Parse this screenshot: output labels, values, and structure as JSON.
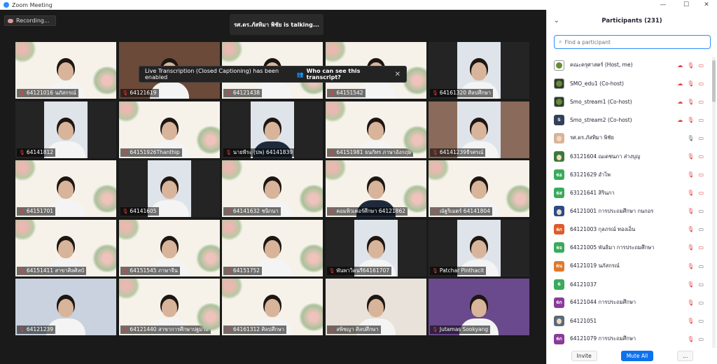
{
  "window": {
    "title": "Zoom Meeting",
    "minimize_icon": "—",
    "maximize_icon": "☐",
    "close_icon": "✕"
  },
  "recording": {
    "label": "Recording..."
  },
  "talking": {
    "text": "รศ.ดร.ภัสทิมา พิชัย is  talking..."
  },
  "banner": {
    "text": "Live Transcription (Closed Captioning) has been enabled",
    "link": "Who can see this transcript?",
    "close": "✕"
  },
  "tiles": [
    {
      "label": "64121016 นภัสกรณ์",
      "bg": "floral",
      "muted": true
    },
    {
      "label": "64121619",
      "bg": "wall",
      "muted": true
    },
    {
      "label": "64121438",
      "bg": "floral",
      "muted": true
    },
    {
      "label": "64151542",
      "bg": "floral",
      "muted": true
    },
    {
      "label": "64161320 ศิลปศึกษา",
      "bg": "dark",
      "muted": true
    },
    {
      "label": "64141812",
      "bg": "dark",
      "muted": true
    },
    {
      "label": "64151926Thanthip",
      "bg": "floral",
      "muted": true
    },
    {
      "label": "นายพีระ (ปพ) 64141839",
      "bg": "dark",
      "muted": true
    },
    {
      "label": "64151981 ธนกัทร ภาษาอังกฤษ",
      "bg": "floral",
      "muted": true
    },
    {
      "label": "64141239ธีรศรณ์",
      "bg": "warm",
      "muted": true
    },
    {
      "label": "64151701",
      "bg": "floral",
      "muted": true
    },
    {
      "label": "64141605",
      "bg": "dark",
      "muted": true
    },
    {
      "label": "64141632 ชนิกนา",
      "bg": "floral",
      "muted": true
    },
    {
      "label": "คอมพิวเตอร์ศึกษา 64121862",
      "bg": "floral",
      "muted": true
    },
    {
      "label": "ณัฐริเมตร์ 64141804",
      "bg": "floral",
      "muted": true
    },
    {
      "label": "64151411 สาขาศิลศิลป์",
      "bg": "floral",
      "muted": true
    },
    {
      "label": "64151545 ภาษาจีน",
      "bg": "floral",
      "muted": true
    },
    {
      "label": "64151752",
      "bg": "floral",
      "muted": true
    },
    {
      "label": "พันพาวิดนรี64161707",
      "bg": "dark",
      "muted": true
    },
    {
      "label": "Patchar Pinthacit",
      "bg": "dark",
      "muted": true
    },
    {
      "label": "64121239",
      "bg": "blue",
      "muted": true
    },
    {
      "label": "64121440 สาขาการศึกษาปฐมวัย",
      "bg": "floral",
      "muted": true
    },
    {
      "label": "64161312 ศิลปศึกษา",
      "bg": "floral",
      "muted": true
    },
    {
      "label": "สพิชญา ศิลปศึกษา",
      "bg": "light",
      "muted": true
    },
    {
      "label": "Jutamas Sookyang",
      "bg": "purple",
      "muted": true
    }
  ],
  "panel": {
    "title": "Participants (231)",
    "collapse_icon": "⌄",
    "search_placeholder": "Find a participant",
    "participants": [
      {
        "name": "คณะครุศาสตร์ (Host, me)",
        "avatar_text": "",
        "avatar_color": "#ffffff",
        "avatar_img": "logo",
        "mic": "off",
        "video": "off",
        "cloud": true
      },
      {
        "name": "SMO_edu1 (Co-host)",
        "avatar_text": "",
        "avatar_color": "#2b3b2b",
        "avatar_img": "logo",
        "mic": "off",
        "video": "off",
        "cloud": true
      },
      {
        "name": "Smo_stream1 (Co-host)",
        "avatar_text": "",
        "avatar_color": "#2b3b2b",
        "avatar_img": "logo",
        "mic": "off",
        "video": "off",
        "cloud": true
      },
      {
        "name": "Smo_stream2 (Co-host)",
        "avatar_text": "S",
        "avatar_color": "#32405a",
        "avatar_img": "",
        "mic": "off",
        "video": "off",
        "cloud": true
      },
      {
        "name": "รศ.ดร.ภัสทิมา พิชัย",
        "avatar_text": "",
        "avatar_color": "#d8b49a",
        "avatar_img": "photo",
        "mic": "on",
        "video": "off",
        "cloud": false
      },
      {
        "name": "63121604 ณเดชนภา ส่างบุญ",
        "avatar_text": "",
        "avatar_color": "#3a7a3a",
        "avatar_img": "photo",
        "mic": "off",
        "video": "off",
        "cloud": false
      },
      {
        "name": "63121629 อำไพ",
        "avatar_text": "6อ",
        "avatar_color": "#3aaa5c",
        "avatar_img": "",
        "mic": "off",
        "video": "off",
        "cloud": false
      },
      {
        "name": "63121641 สิรินภา",
        "avatar_text": "6ส",
        "avatar_color": "#3aaa5c",
        "avatar_img": "",
        "mic": "off",
        "video": "off",
        "cloud": false
      },
      {
        "name": "64121001 การประถมศึกษา กนกอร",
        "avatar_text": "",
        "avatar_color": "#2b4b8a",
        "avatar_img": "photo",
        "mic": "off",
        "video": "on",
        "cloud": false
      },
      {
        "name": "64121003 กุลภรณ์ ทองเอ็น",
        "avatar_text": "6ก",
        "avatar_color": "#e05a2a",
        "avatar_img": "",
        "mic": "off",
        "video": "on",
        "cloud": false
      },
      {
        "name": "64121005 พันธิมา  การประถมศึกษา",
        "avatar_text": "6จ",
        "avatar_color": "#3aaa5c",
        "avatar_img": "",
        "mic": "off",
        "video": "off",
        "cloud": false
      },
      {
        "name": "64121019 นภัสกรณ์",
        "avatar_text": "6น",
        "avatar_color": "#e0782a",
        "avatar_img": "",
        "mic": "off",
        "video": "on",
        "cloud": false
      },
      {
        "name": "64121037",
        "avatar_text": "6",
        "avatar_color": "#3aaa5c",
        "avatar_img": "",
        "mic": "off",
        "video": "on",
        "cloud": false
      },
      {
        "name": "64121044 การประถมศึกษา",
        "avatar_text": "6ก",
        "avatar_color": "#8a3a9a",
        "avatar_img": "",
        "mic": "off",
        "video": "on",
        "cloud": false
      },
      {
        "name": "64121051",
        "avatar_text": "",
        "avatar_color": "#5a6a7a",
        "avatar_img": "photo",
        "mic": "off",
        "video": "on",
        "cloud": false
      },
      {
        "name": "64121079 การประถมศึกษา",
        "avatar_text": "6ก",
        "avatar_color": "#8a3a9a",
        "avatar_img": "",
        "mic": "off",
        "video": "on",
        "cloud": false
      }
    ],
    "invite_label": "Invite",
    "mute_all_label": "Mute All",
    "more_label": "..."
  }
}
